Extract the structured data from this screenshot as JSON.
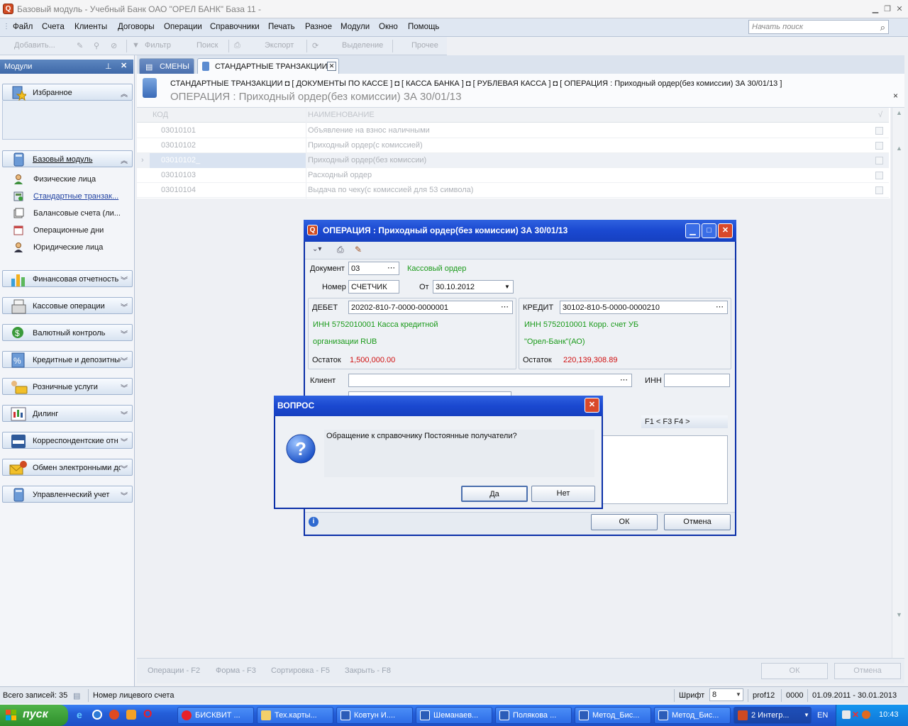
{
  "window": {
    "title": "Базовый модуль - Учебный Банк ОАО \"ОРЕЛ БАНК\" База 11 -"
  },
  "menu": [
    "Файл",
    "Счета",
    "Клиенты",
    "Договоры",
    "Операции",
    "Справочники",
    "Печать",
    "Разное",
    "Модули",
    "Окно",
    "Помощь"
  ],
  "search": {
    "placeholder": "Начать поиск"
  },
  "toolbar": {
    "add": "Добавить...",
    "filter": "Фильтр",
    "search": "Поиск",
    "export": "Экспорт",
    "select": "Выделение",
    "other": "Прочее"
  },
  "sidebar": {
    "header": "Модули",
    "favorites": "Избранное",
    "base_module": "Базовый модуль",
    "sub_items": [
      "Физические лица",
      "Стандартные транзак...",
      "Балансовые счета (ли...",
      "Операционные дни",
      "Юридические лица"
    ],
    "groups": [
      "Финансовая отчетность",
      "Кассовые операции",
      "Валютный контроль",
      "Кредитные и депозитные",
      "Розничные услуги",
      "Дилинг",
      "Корреспондентские отн",
      "Обмен электронными до",
      "Управленческий учет"
    ]
  },
  "tabs": {
    "shifts": "СМЕНЫ",
    "std": "СТАНДАРТНЫЕ ТРАНЗАКЦИИ"
  },
  "breadcrumb": {
    "path": "СТАНДАРТНЫЕ ТРАНЗАКЦИИ  ◘ [ ДОКУМЕНТЫ ПО КАССЕ ] ◘ [ КАССА БАНКА ] ◘ [ РУБЛЕВАЯ КАССА ] ◘ [ ОПЕРАЦИЯ : Приходный ордер(без комиссии) ЗА 30/01/13 ]",
    "title": "ОПЕРАЦИЯ : Приходный ордер(без комиссии) ЗА 30/01/13"
  },
  "grid": {
    "headers": [
      "КОД",
      "НАИМЕНОВАНИЕ"
    ],
    "rows": [
      {
        "code": "03010101",
        "name": "Объявление на взнос наличными"
      },
      {
        "code": "03010102",
        "name": "Приходный ордер(с комиссией)"
      },
      {
        "code": "03010102_",
        "name": "Приходный ордер(без комиссии)"
      },
      {
        "code": "03010103",
        "name": "Расходный ордер"
      },
      {
        "code": "03010104",
        "name": "Выдача по чеку(с комиссией для 53 символа)"
      }
    ]
  },
  "bottom": {
    "f2": "Операции - F2",
    "f3": "Форма - F3",
    "f5": "Сортировка - F5",
    "f8": "Закрыть - F8",
    "ok": "ОК",
    "cancel": "Отмена"
  },
  "status": {
    "records": "Всего записей: 35",
    "account": "Номер лицевого счета",
    "font_label": "Шрифт",
    "font_value": "8",
    "user": "prof12",
    "code": "0000",
    "period": "01.09.2011 - 30.01.2013"
  },
  "taskbar": {
    "start": "пуск",
    "tasks": [
      "БИСКВИТ ...",
      "Тех.карты...",
      "Ковтун И....",
      "Шеманаев...",
      "Полякова ...",
      "Метод_Бис...",
      "Метод_Бис...",
      "2 Интегр..."
    ],
    "lang": "EN",
    "clock": "10:43"
  },
  "opdialog": {
    "title": "ОПЕРАЦИЯ : Приходный ордер(без комиссии) ЗА 30/01/13",
    "doc_label": "Документ",
    "doc_value": "03",
    "doc_type": "Кассовый ордер",
    "num_label": "Номер",
    "num_value": "СЧЕТЧИК",
    "date_label": "От",
    "date_value": "30.10.2012",
    "debit_label": "ДЕБЕТ",
    "debit_account": "20202-810-7-0000-0000001",
    "debit_desc1": "ИНН 5752010001 Касса кредитной",
    "debit_desc2": "организации RUB",
    "debit_bal_label": "Остаток",
    "debit_bal": "1,500,000.00",
    "credit_label": "КРЕДИТ",
    "credit_account": "30102-810-5-0000-0000210",
    "credit_desc1": "ИНН 5752010001 Корр. счет УБ",
    "credit_desc2": "\"Орел-Банк\"(АО)",
    "credit_bal_label": "Остаток",
    "credit_bal": "220,139,308.89",
    "client_label": "Клиент",
    "inn_label": "ИНН",
    "fkeys": "F1   < F3  F4 >",
    "ok": "ОК",
    "cancel": "Отмена"
  },
  "question": {
    "title": "ВОПРОС",
    "text": "Обращение к справочнику Постоянные получатели?",
    "yes": "Да",
    "no": "Нет"
  }
}
